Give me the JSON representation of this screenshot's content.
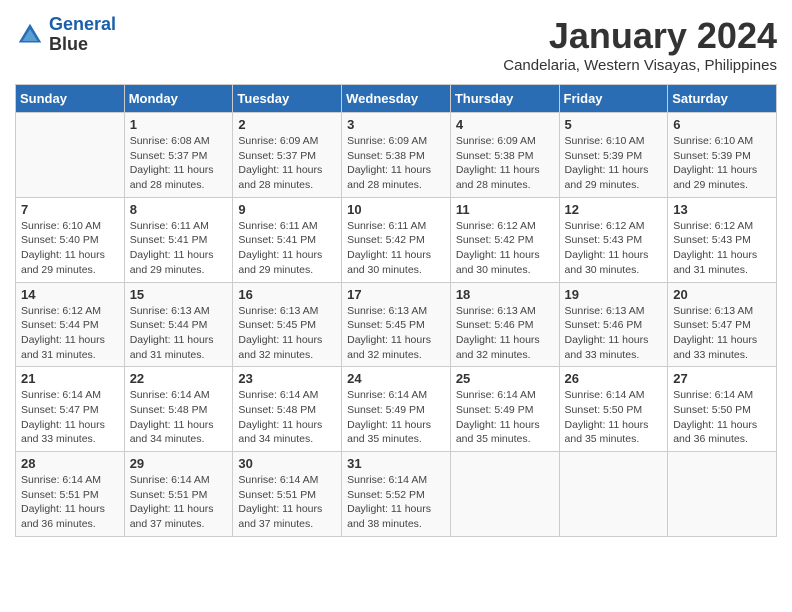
{
  "header": {
    "logo_line1": "General",
    "logo_line2": "Blue",
    "month": "January 2024",
    "location": "Candelaria, Western Visayas, Philippines"
  },
  "days_of_week": [
    "Sunday",
    "Monday",
    "Tuesday",
    "Wednesday",
    "Thursday",
    "Friday",
    "Saturday"
  ],
  "weeks": [
    [
      {
        "day": "",
        "sunrise": "",
        "sunset": "",
        "daylight": ""
      },
      {
        "day": "1",
        "sunrise": "6:08 AM",
        "sunset": "5:37 PM",
        "daylight": "11 hours and 28 minutes."
      },
      {
        "day": "2",
        "sunrise": "6:09 AM",
        "sunset": "5:37 PM",
        "daylight": "11 hours and 28 minutes."
      },
      {
        "day": "3",
        "sunrise": "6:09 AM",
        "sunset": "5:38 PM",
        "daylight": "11 hours and 28 minutes."
      },
      {
        "day": "4",
        "sunrise": "6:09 AM",
        "sunset": "5:38 PM",
        "daylight": "11 hours and 28 minutes."
      },
      {
        "day": "5",
        "sunrise": "6:10 AM",
        "sunset": "5:39 PM",
        "daylight": "11 hours and 29 minutes."
      },
      {
        "day": "6",
        "sunrise": "6:10 AM",
        "sunset": "5:39 PM",
        "daylight": "11 hours and 29 minutes."
      }
    ],
    [
      {
        "day": "7",
        "sunrise": "6:10 AM",
        "sunset": "5:40 PM",
        "daylight": "11 hours and 29 minutes."
      },
      {
        "day": "8",
        "sunrise": "6:11 AM",
        "sunset": "5:41 PM",
        "daylight": "11 hours and 29 minutes."
      },
      {
        "day": "9",
        "sunrise": "6:11 AM",
        "sunset": "5:41 PM",
        "daylight": "11 hours and 29 minutes."
      },
      {
        "day": "10",
        "sunrise": "6:11 AM",
        "sunset": "5:42 PM",
        "daylight": "11 hours and 30 minutes."
      },
      {
        "day": "11",
        "sunrise": "6:12 AM",
        "sunset": "5:42 PM",
        "daylight": "11 hours and 30 minutes."
      },
      {
        "day": "12",
        "sunrise": "6:12 AM",
        "sunset": "5:43 PM",
        "daylight": "11 hours and 30 minutes."
      },
      {
        "day": "13",
        "sunrise": "6:12 AM",
        "sunset": "5:43 PM",
        "daylight": "11 hours and 31 minutes."
      }
    ],
    [
      {
        "day": "14",
        "sunrise": "6:12 AM",
        "sunset": "5:44 PM",
        "daylight": "11 hours and 31 minutes."
      },
      {
        "day": "15",
        "sunrise": "6:13 AM",
        "sunset": "5:44 PM",
        "daylight": "11 hours and 31 minutes."
      },
      {
        "day": "16",
        "sunrise": "6:13 AM",
        "sunset": "5:45 PM",
        "daylight": "11 hours and 32 minutes."
      },
      {
        "day": "17",
        "sunrise": "6:13 AM",
        "sunset": "5:45 PM",
        "daylight": "11 hours and 32 minutes."
      },
      {
        "day": "18",
        "sunrise": "6:13 AM",
        "sunset": "5:46 PM",
        "daylight": "11 hours and 32 minutes."
      },
      {
        "day": "19",
        "sunrise": "6:13 AM",
        "sunset": "5:46 PM",
        "daylight": "11 hours and 33 minutes."
      },
      {
        "day": "20",
        "sunrise": "6:13 AM",
        "sunset": "5:47 PM",
        "daylight": "11 hours and 33 minutes."
      }
    ],
    [
      {
        "day": "21",
        "sunrise": "6:14 AM",
        "sunset": "5:47 PM",
        "daylight": "11 hours and 33 minutes."
      },
      {
        "day": "22",
        "sunrise": "6:14 AM",
        "sunset": "5:48 PM",
        "daylight": "11 hours and 34 minutes."
      },
      {
        "day": "23",
        "sunrise": "6:14 AM",
        "sunset": "5:48 PM",
        "daylight": "11 hours and 34 minutes."
      },
      {
        "day": "24",
        "sunrise": "6:14 AM",
        "sunset": "5:49 PM",
        "daylight": "11 hours and 35 minutes."
      },
      {
        "day": "25",
        "sunrise": "6:14 AM",
        "sunset": "5:49 PM",
        "daylight": "11 hours and 35 minutes."
      },
      {
        "day": "26",
        "sunrise": "6:14 AM",
        "sunset": "5:50 PM",
        "daylight": "11 hours and 35 minutes."
      },
      {
        "day": "27",
        "sunrise": "6:14 AM",
        "sunset": "5:50 PM",
        "daylight": "11 hours and 36 minutes."
      }
    ],
    [
      {
        "day": "28",
        "sunrise": "6:14 AM",
        "sunset": "5:51 PM",
        "daylight": "11 hours and 36 minutes."
      },
      {
        "day": "29",
        "sunrise": "6:14 AM",
        "sunset": "5:51 PM",
        "daylight": "11 hours and 37 minutes."
      },
      {
        "day": "30",
        "sunrise": "6:14 AM",
        "sunset": "5:51 PM",
        "daylight": "11 hours and 37 minutes."
      },
      {
        "day": "31",
        "sunrise": "6:14 AM",
        "sunset": "5:52 PM",
        "daylight": "11 hours and 38 minutes."
      },
      {
        "day": "",
        "sunrise": "",
        "sunset": "",
        "daylight": ""
      },
      {
        "day": "",
        "sunrise": "",
        "sunset": "",
        "daylight": ""
      },
      {
        "day": "",
        "sunrise": "",
        "sunset": "",
        "daylight": ""
      }
    ]
  ],
  "labels": {
    "sunrise_prefix": "Sunrise: ",
    "sunset_prefix": "Sunset: ",
    "daylight_prefix": "Daylight: "
  }
}
